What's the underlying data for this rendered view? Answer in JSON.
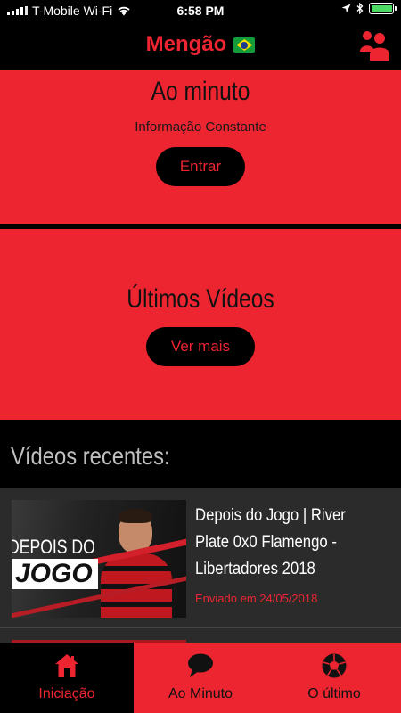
{
  "status_bar": {
    "carrier": "T-Mobile Wi-Fi",
    "time": "6:58 PM",
    "battery_color": "#4cd964"
  },
  "nav": {
    "title": "Mengão",
    "flag_icon": "brazil-flag-icon",
    "profile_icon": "users-icon"
  },
  "cards": [
    {
      "title": "Ao minuto",
      "subtitle": "Informação Constante",
      "button": "Entrar"
    },
    {
      "title": "Últimos Vídeos",
      "button": "Ver mais"
    }
  ],
  "recent": {
    "heading": "Vídeos recentes:",
    "videos": [
      {
        "thumbnail_lines": [
          "DEPOIS DO",
          "JOGO"
        ],
        "title": "Depois do Jogo | River Plate 0x0 Flamengo - Libertadores 2018",
        "meta": "Enviado em 24/05/2018"
      }
    ]
  },
  "tabs": [
    {
      "label": "Iniciação",
      "icon": "home-icon",
      "active": true
    },
    {
      "label": "Ao Minuto",
      "icon": "chat-bubble-icon",
      "active": false
    },
    {
      "label": "O último",
      "icon": "soccer-ball-icon",
      "active": false
    }
  ],
  "colors": {
    "accent": "#ec2531",
    "background": "#000000",
    "list_bg": "#2b2b2b",
    "heading_gray": "#bfbfbf"
  }
}
